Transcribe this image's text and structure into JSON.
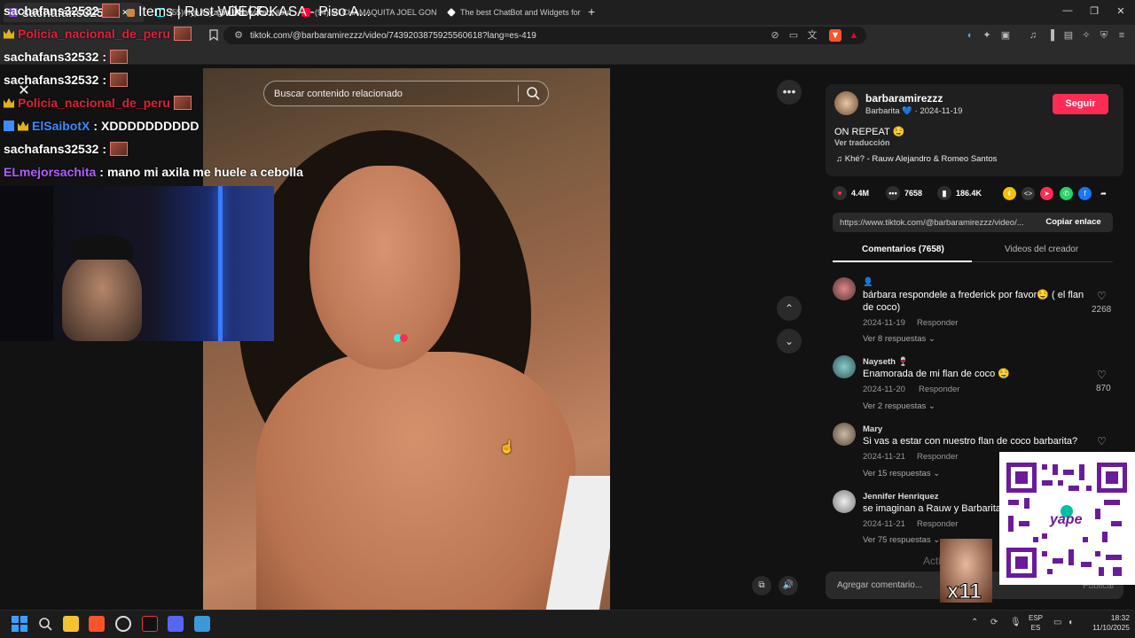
{
  "tabs": [
    {
      "label": "sachafans32532",
      "active": true
    },
    {
      "label": "(55)#fyp #xyzcba #brawlstars #brawl"
    },
    {
      "label": "(94) MI CHAMAQUITA JOEL GONZAL"
    },
    {
      "label": "The best ChatBot and Widgets for Ki"
    }
  ],
  "new_tab": "+",
  "window_controls": {
    "minimize": "—",
    "restore": "❐",
    "close": "✕"
  },
  "address": {
    "url": "tiktok.com/@barbaramirezzz/video/7439203875925560618?lang=es-419"
  },
  "bookmarks": [
    {
      "label": "Items | Rust Wiki | F..."
    },
    {
      "label": "DECOKASA - Piso A..."
    }
  ],
  "search": {
    "placeholder": "Buscar contenido relacionado"
  },
  "chat": [
    {
      "user": "sachafans32532",
      "color": "#ffffff",
      "msg": "",
      "badges": []
    },
    {
      "user": "Policia_nacional_de_peru",
      "color": "#e0203a",
      "msg": "",
      "badges": [
        "crown"
      ]
    },
    {
      "user": "sachafans32532",
      "color": "#ffffff",
      "msg": "",
      "badges": []
    },
    {
      "user": "sachafans32532",
      "color": "#ffffff",
      "msg": "",
      "badges": []
    },
    {
      "user": "Policia_nacional_de_peru",
      "color": "#e0203a",
      "msg": "",
      "badges": [
        "crown"
      ]
    },
    {
      "user": "ElSaibotX",
      "color": "#3b8cff",
      "msg": "XDDDDDDDDDD",
      "badges": [
        "sub",
        "crown"
      ]
    },
    {
      "user": "sachafans32532",
      "color": "#ffffff",
      "msg": "",
      "badges": []
    },
    {
      "user": "ELmejorsachita",
      "color": "#b05cff",
      "msg": "mano mi axila me huele a cebolla",
      "badges": []
    }
  ],
  "colon": ":",
  "creator": {
    "username": "barbaramirezzz",
    "display": "Barbarita 💙 · 2024-11-19",
    "follow": "Seguir",
    "caption": "ON REPEAT 🤤",
    "translate": "Ver traducción",
    "music": "♫  Khé? - Rauw Alejandro & Romeo Santos"
  },
  "stats": {
    "likes": "4.4M",
    "comments": "7658",
    "saves": "186.4K"
  },
  "link": {
    "url": "https://www.tiktok.com/@barbaramirezzz/video/...",
    "copy": "Copiar enlace"
  },
  "side_tabs": {
    "comments": "Comentarios (7658)",
    "creator_videos": "Videos del creador"
  },
  "comments": [
    {
      "name": "👤",
      "text": "bárbara respondele a frederick por favor🤤 ( el flan de coco)",
      "date": "2024-11-19",
      "reply": "Responder",
      "replies": "Ver 8 respuestas ⌄",
      "likes": "2268"
    },
    {
      "name": "Nayseth 🍷",
      "text": "Enamorada de mi flan de coco 🤤",
      "date": "2024-11-20",
      "reply": "Responder",
      "replies": "Ver 2 respuestas ⌄",
      "likes": "870"
    },
    {
      "name": "Mary",
      "text": "Si vas a estar con nuestro flan de coco barbarita?",
      "date": "2024-11-21",
      "reply": "Responder",
      "replies": "Ver 15 respuestas ⌄",
      "likes": ""
    },
    {
      "name": "Jennifer Henriquez",
      "text": "se imaginan a Rauw y Barbarita",
      "date": "2024-11-21",
      "reply": "Responder",
      "replies": "Ver 75 respuestas ⌄",
      "likes": ""
    }
  ],
  "comment_input": {
    "placeholder": "Agregar comentario...",
    "post": "Publicar"
  },
  "overlay": {
    "activate": "Acti",
    "multiplier": "x11",
    "qr_brand": "yape"
  },
  "taskbar": {
    "lang_top": "ESP",
    "lang_bottom": "ES",
    "time": "18:32",
    "date": "11/10/2025"
  },
  "colors": {
    "accent": "#fe2c55",
    "qr_purple": "#6a1b9a"
  }
}
